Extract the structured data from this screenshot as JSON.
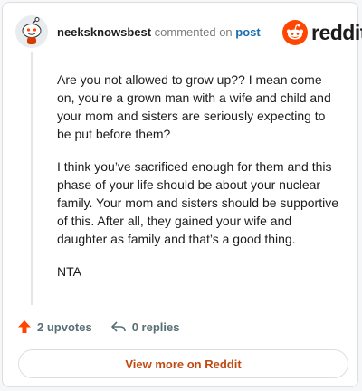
{
  "header": {
    "author": "neeksknowsbest",
    "action_text": "commented on",
    "post_link": "post",
    "brand": "reddit"
  },
  "comment": {
    "paragraphs": [
      "Are you not allowed to grow up?? I mean come on, you’re a grown man with a wife and child and your mom and sisters are seriously expecting to be put before them?",
      "I think you’ve sacrificed enough for them and this phase of your life should be about your nuclear family. Your mom and sisters should be supportive of this. After all, they gained your wife and daughter as family and that’s a good thing.",
      "NTA"
    ]
  },
  "actions": {
    "upvotes": "2 upvotes",
    "replies": "0 replies"
  },
  "view_more": "View more on Reddit",
  "colors": {
    "brand_orange": "#ff4500",
    "link_blue": "#1a6fb0",
    "view_more_text": "#c14a12"
  }
}
